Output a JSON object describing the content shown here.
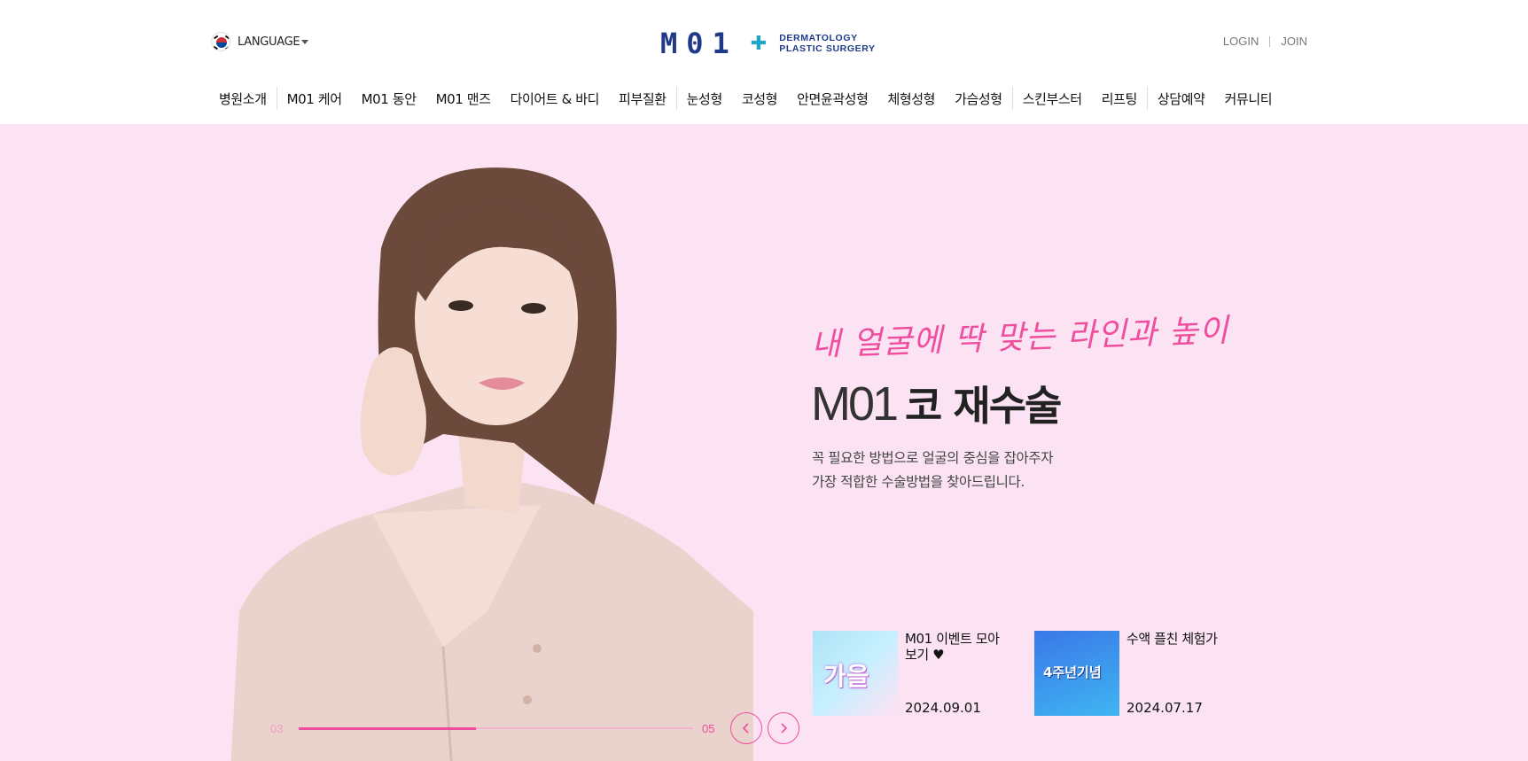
{
  "header": {
    "language_label": "LANGUAGE",
    "logo": {
      "mark": "M01",
      "line1": "DERMATOLOGY",
      "line2": "PLASTIC SURGERY"
    },
    "auth": {
      "login": "LOGIN",
      "join": "JOIN"
    },
    "nav": [
      "병원소개",
      "M01 케어",
      "M01 동안",
      "M01 맨즈",
      "다이어트 & 바디",
      "피부질환",
      "눈성형",
      "코성형",
      "안면윤곽성형",
      "체형성형",
      "가슴성형",
      "스킨부스터",
      "리프팅",
      "상담예약",
      "커뮤니티"
    ]
  },
  "hero": {
    "script_text": "내 얼굴에 딱 맞는 라인과 높이",
    "headline_thin": "M01",
    "headline_bold": "코 재수술",
    "desc_line1": "꼭 필요한 방법으로 얼굴의 중심을 잡아주자",
    "desc_line2": "가장 적합한 수술방법을 찾아드립니다.",
    "slider": {
      "current": "03",
      "total": "05",
      "progress": 0.45
    },
    "colors": {
      "background": "#fce3f3",
      "accent": "#ef4d9d"
    }
  },
  "events": [
    {
      "title": "M01 이벤트 모아보기 ♥",
      "date": "2024.09.01",
      "thumb_text": "가을"
    },
    {
      "title": "수액 플친 체험가",
      "date": "2024.07.17",
      "thumb_text": "4주년기념"
    }
  ]
}
